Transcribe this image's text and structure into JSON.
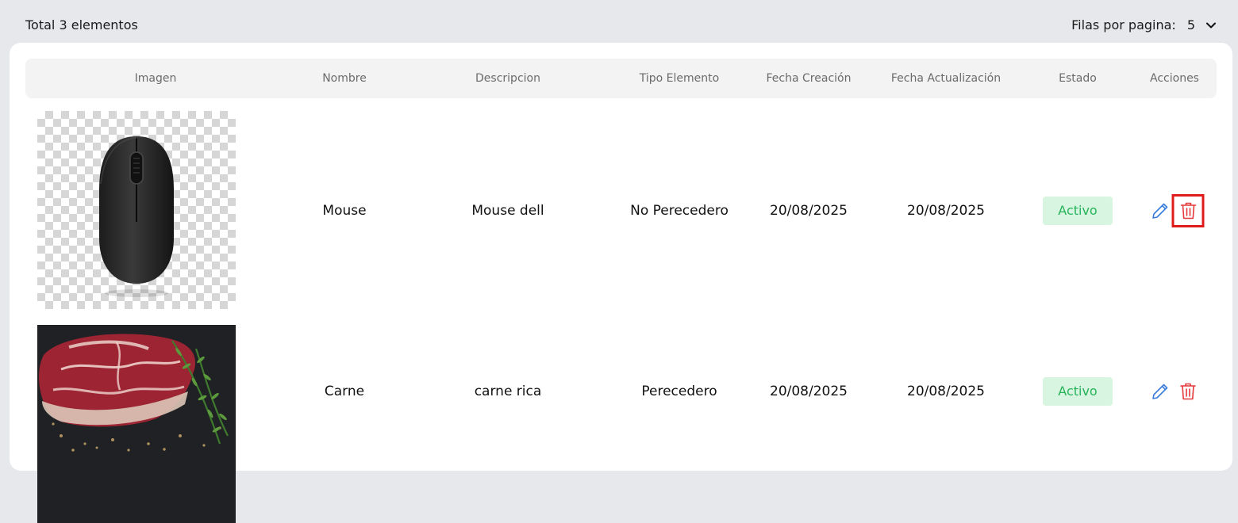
{
  "header": {
    "total_label": "Total 3 elementos",
    "rows_per_page_label": "Filas por pagina:",
    "rows_per_page_value": "5"
  },
  "table": {
    "columns": [
      "Imagen",
      "Nombre",
      "Descripcion",
      "Tipo Elemento",
      "Fecha Creación",
      "Fecha Actualización",
      "Estado",
      "Acciones"
    ],
    "rows": [
      {
        "image": "mouse-image",
        "nombre": "Mouse",
        "descripcion": "Mouse dell",
        "tipo": "No Perecedero",
        "fecha_creacion": "20/08/2025",
        "fecha_actualizacion": "20/08/2025",
        "estado": "Activo"
      },
      {
        "image": "meat-image",
        "nombre": "Carne",
        "descripcion": "carne rica",
        "tipo": "Perecedero",
        "fecha_creacion": "20/08/2025",
        "fecha_actualizacion": "20/08/2025",
        "estado": "Activo"
      }
    ]
  },
  "colors": {
    "page_bg": "#e7e8ec",
    "header_bg": "#f3f3f4",
    "status_bg": "#d7f5e0",
    "status_text": "#27b35a",
    "edit_icon": "#3b7ddd",
    "delete_icon": "#e5383b",
    "highlight_border": "#e01b1b"
  },
  "icons": {
    "edit": "pencil-icon",
    "delete": "trash-icon",
    "dropdown": "chevron-down-icon"
  }
}
